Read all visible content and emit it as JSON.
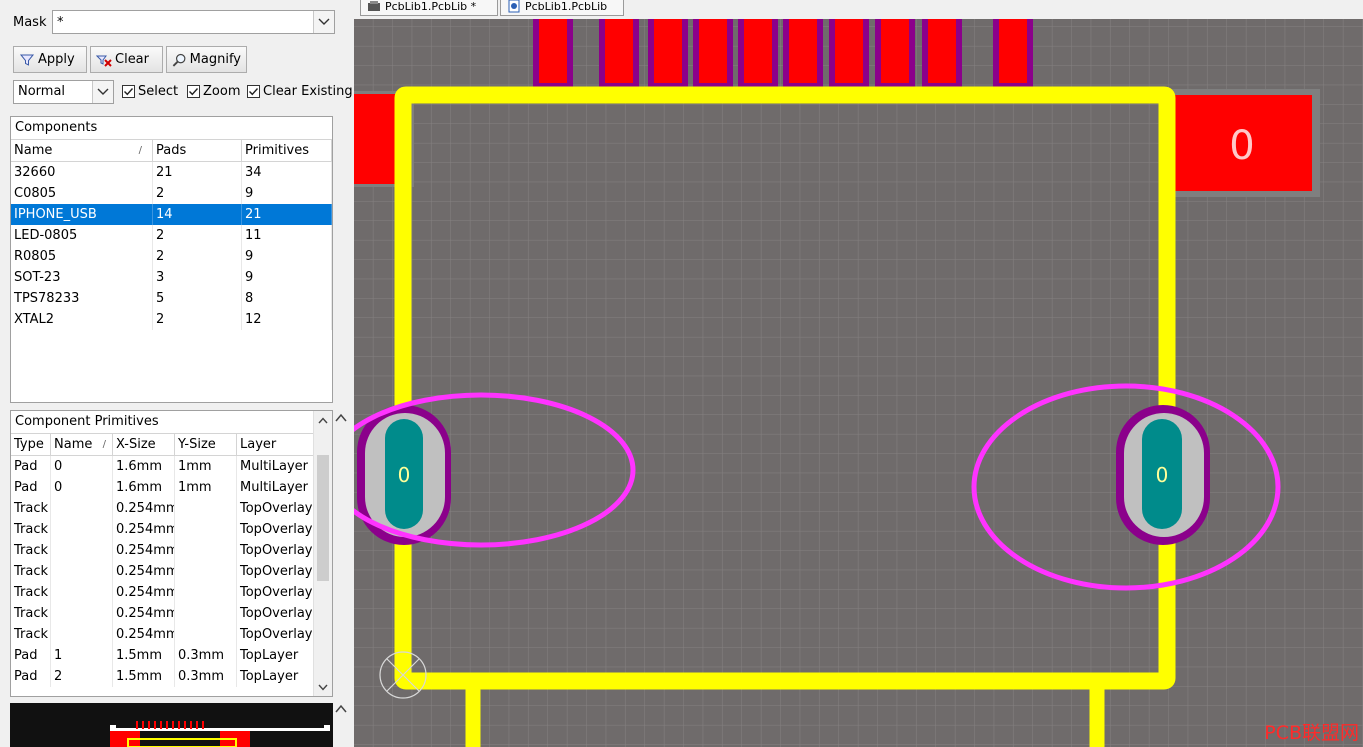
{
  "filter": {
    "mask_label": "Mask",
    "mask_value": "*",
    "apply_label": "Apply",
    "clear_label": "Clear",
    "magnify_label": "Magnify",
    "mode_value": "Normal",
    "select_label": "Select",
    "zoom_label": "Zoom",
    "clear_existing_label": "Clear Existing",
    "select_checked": true,
    "zoom_checked": true,
    "clear_existing_checked": true
  },
  "components": {
    "title": "Components",
    "columns": [
      "Name",
      "Pads",
      "Primitives"
    ],
    "sort_indicator": "/",
    "rows": [
      {
        "name": "32660",
        "pads": "21",
        "primitives": "34"
      },
      {
        "name": "C0805",
        "pads": "2",
        "primitives": "9"
      },
      {
        "name": "IPHONE_USB",
        "pads": "14",
        "primitives": "21"
      },
      {
        "name": "LED-0805",
        "pads": "2",
        "primitives": "11"
      },
      {
        "name": "R0805",
        "pads": "2",
        "primitives": "9"
      },
      {
        "name": "SOT-23",
        "pads": "3",
        "primitives": "9"
      },
      {
        "name": "TPS78233",
        "pads": "5",
        "primitives": "8"
      },
      {
        "name": "XTAL2",
        "pads": "2",
        "primitives": "12"
      }
    ],
    "selected_index": 2
  },
  "primitives": {
    "title": "Component Primitives",
    "columns": [
      "Type",
      "Name",
      "X-Size",
      "Y-Size",
      "Layer"
    ],
    "sort_indicator": "/",
    "rows": [
      {
        "type": "Pad",
        "name": "0",
        "xsize": "1.6mm",
        "ysize": "1mm",
        "layer": "MultiLayer"
      },
      {
        "type": "Pad",
        "name": "0",
        "xsize": "1.6mm",
        "ysize": "1mm",
        "layer": "MultiLayer"
      },
      {
        "type": "Track",
        "name": "",
        "xsize": "0.254mm",
        "ysize": "",
        "layer": "TopOverlay"
      },
      {
        "type": "Track",
        "name": "",
        "xsize": "0.254mm",
        "ysize": "",
        "layer": "TopOverlay"
      },
      {
        "type": "Track",
        "name": "",
        "xsize": "0.254mm",
        "ysize": "",
        "layer": "TopOverlay"
      },
      {
        "type": "Track",
        "name": "",
        "xsize": "0.254mm",
        "ysize": "",
        "layer": "TopOverlay"
      },
      {
        "type": "Track",
        "name": "",
        "xsize": "0.254mm",
        "ysize": "",
        "layer": "TopOverlay"
      },
      {
        "type": "Track",
        "name": "",
        "xsize": "0.254mm",
        "ysize": "",
        "layer": "TopOverlay"
      },
      {
        "type": "Track",
        "name": "",
        "xsize": "0.254mm",
        "ysize": "",
        "layer": "TopOverlay"
      },
      {
        "type": "Pad",
        "name": "1",
        "xsize": "1.5mm",
        "ysize": "0.3mm",
        "layer": "TopLayer"
      },
      {
        "type": "Pad",
        "name": "2",
        "xsize": "1.5mm",
        "ysize": "0.3mm",
        "layer": "TopLayer"
      }
    ]
  },
  "tabs": [
    {
      "label": "PcbLib1.PcbLib *"
    },
    {
      "label": "PcbLib1.PcbLib"
    }
  ],
  "canvas": {
    "pad_label_left": "0",
    "pad_label_right": "0",
    "big_pad_label": "0",
    "colors": {
      "background": "#6f6b6b",
      "grid": "#858181",
      "overlay": "#ffff00",
      "top_pad": "#ff0000",
      "pad_outline": "#8b008b",
      "multilayer_pad": "#c0c0c0",
      "hole": "#008b8b",
      "highlight": "#ff33ff"
    }
  },
  "watermark": "PCB联盟网"
}
